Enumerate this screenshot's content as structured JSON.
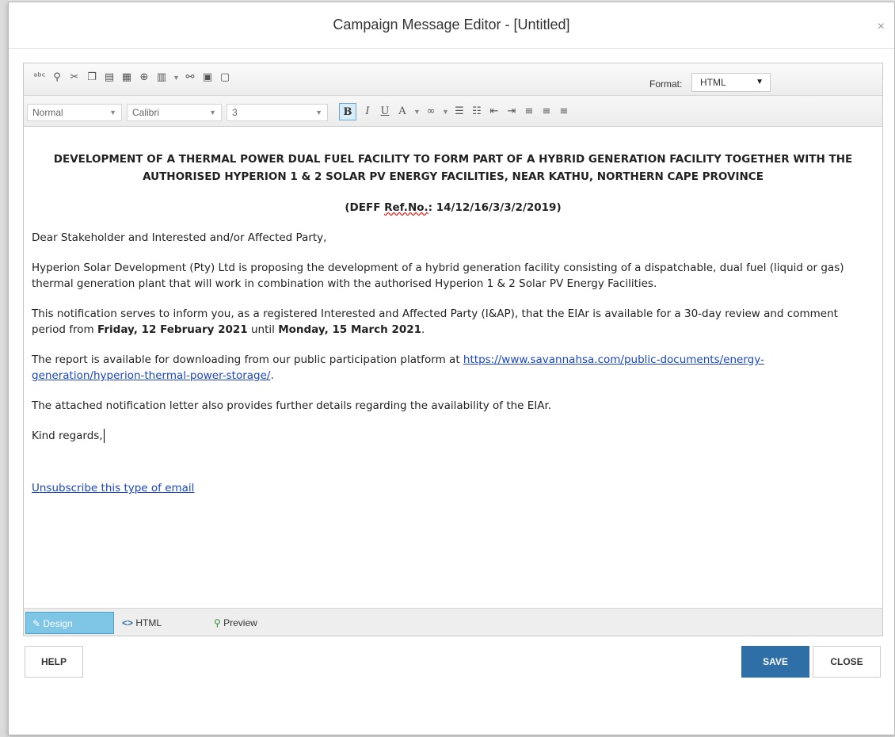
{
  "dialog": {
    "title": "Campaign Message Editor - [Untitled]",
    "close_glyph": "×"
  },
  "toolbar": {
    "format_label": "Format:",
    "format_value": "HTML",
    "paragraph_style": "Normal",
    "font_family": "Calibri",
    "font_size": "3",
    "bold_label": "B"
  },
  "content": {
    "heading": "DEVELOPMENT OF A THERMAL POWER DUAL FUEL FACILITY TO FORM PART OF A HYBRID GENERATION FACILITY TOGETHER WITH THE AUTHORISED HYPERION 1 & 2 SOLAR PV ENERGY FACILITIES, NEAR KATHU, NORTHERN CAPE PROVINCE",
    "ref_prefix": "(DEFF ",
    "ref_label": "Ref.No.",
    "ref_suffix": ":  14/12/16/3/3/2/2019)",
    "greeting": "Dear Stakeholder and Interested and/or Affected Party,",
    "para1": "Hyperion Solar Development (Pty) Ltd is proposing the development of a hybrid generation facility consisting of a dispatchable, dual fuel (liquid or gas) thermal generation plant that will work in combination with the authorised Hyperion 1 & 2 Solar PV Energy Facilities.",
    "para2_a": "This notification serves to inform you, as a registered Interested and Affected Party (I&AP), that the EIAr is available for a 30-day review and comment period from ",
    "para2_date1": "Friday, 12 February 2021",
    "para2_mid": " until ",
    "para2_date2": "Monday, 15 March 2021",
    "para2_end": ".",
    "para3_a": "The report is available for downloading from our public participation platform at ",
    "para3_link": "https://www.savannahsa.com/public-documents/energy-generation/hyperion-thermal-power-storage/",
    "para3_end": ".",
    "para4": "The attached notification letter also provides further details regarding the availability of the EIAr.",
    "closing": "Kind regards,",
    "unsubscribe": "Unsubscribe this type of email"
  },
  "modes": {
    "design": "Design",
    "html": "HTML",
    "preview": "Preview"
  },
  "buttons": {
    "help": "HELP",
    "save": "SAVE",
    "close": "CLOSE"
  },
  "colors": {
    "accent": "#2f6fa7",
    "active_tab": "#7fc6e6",
    "link": "#1a44c8"
  }
}
